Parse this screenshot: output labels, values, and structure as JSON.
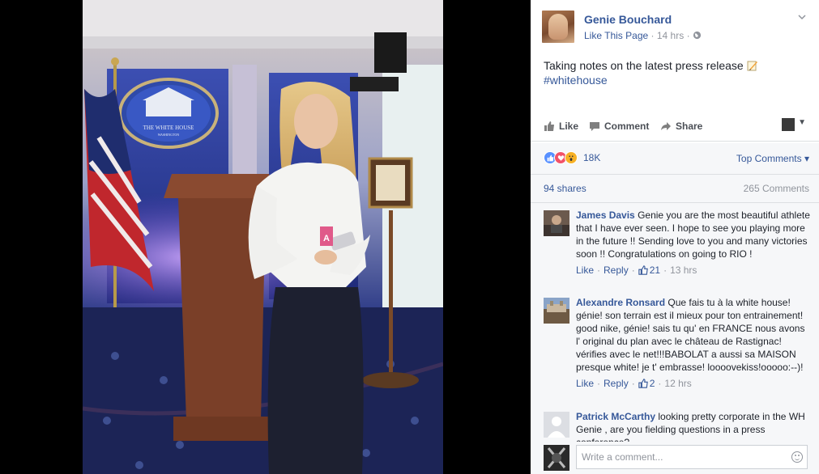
{
  "post": {
    "author": "Genie Bouchard",
    "like_page": "Like This Page",
    "separator": "·",
    "time": "14 hrs",
    "text": "Taking notes on the latest press release",
    "hashtag": "#whitehouse",
    "pencil_icon": "memo-icon"
  },
  "photo": {
    "seal_text": "THE WHITE HOUSE",
    "seal_subtext": "WASHINGTON",
    "badge_letter": "A"
  },
  "actions": {
    "like": "Like",
    "comment": "Comment",
    "share": "Share"
  },
  "reactions": {
    "count": "18K",
    "sort_label": "Top Comments",
    "sort_caret": "▾",
    "icons": [
      "like-icon",
      "love-icon",
      "wow-icon"
    ]
  },
  "counts": {
    "shares": "94 shares",
    "comments": "265 Comments"
  },
  "comments": [
    {
      "name": "James Davis",
      "text": "Genie you are the most beautiful athlete that I have ever seen. I hope to see you playing more in the future !! Sending love to you and many victories soon !! Congratulations on going to RIO !",
      "like": "Like",
      "reply": "Reply",
      "likes": "21",
      "time": "13 hrs"
    },
    {
      "name": "Alexandre Ronsard",
      "text": "Que fais tu à la white house! génie! son terrain est il mieux pour ton entrainement! good nike, génie! sais tu qu' en FRANCE nous avons l' original du plan avec le château de Rastignac! vérifies avec le net!!!BABOLAT a aussi sa MAISON presque white! je t' embrasse! loooovekiss!ooooo:--)!",
      "like": "Like",
      "reply": "Reply",
      "likes": "2",
      "time": "12 hrs"
    },
    {
      "name": "Patrick McCarthy",
      "text": "looking pretty corporate in the WH Genie , are you fielding questions in a press conference?"
    }
  ],
  "composer": {
    "placeholder": "Write a comment..."
  },
  "colors": {
    "link": "#365899",
    "muted": "#90949c",
    "panel_bg": "#f6f7f9"
  }
}
